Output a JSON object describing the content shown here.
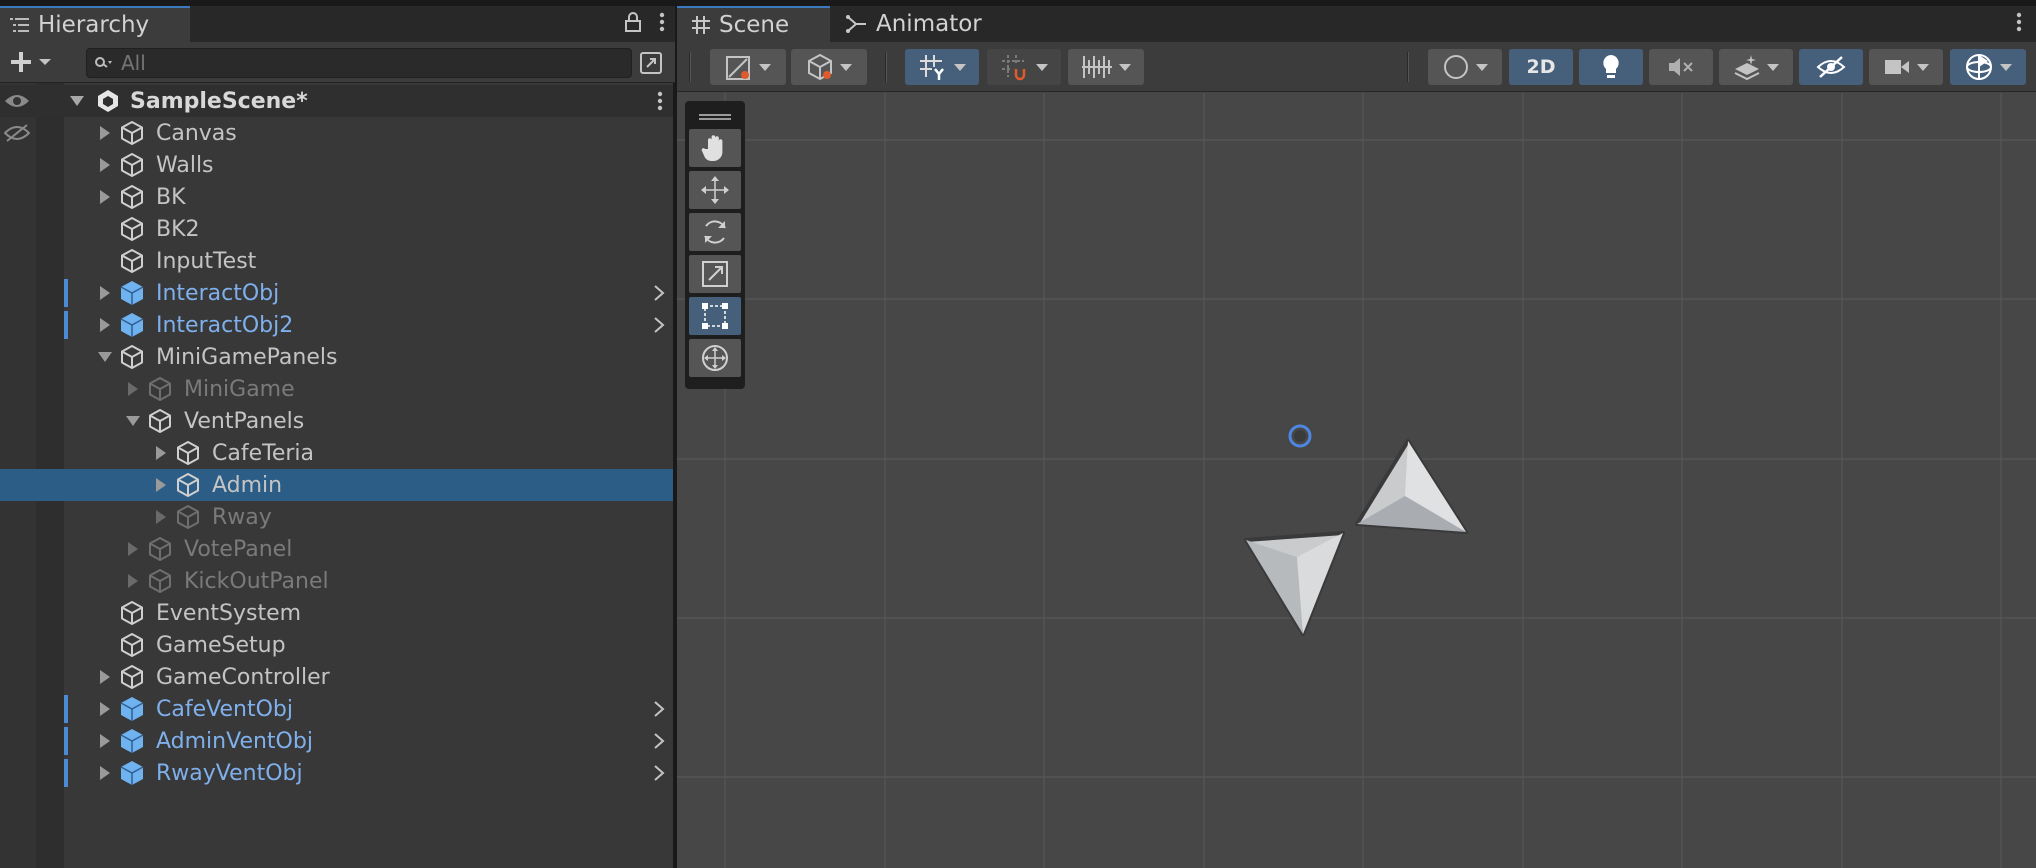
{
  "hierarchy": {
    "tab_title": "Hierarchy",
    "search_placeholder": "All",
    "scene_name": "SampleScene*",
    "items": [
      {
        "label": "Canvas",
        "type": "normal",
        "indent": 0,
        "fold": "collapsed",
        "mark": false
      },
      {
        "label": "Walls",
        "type": "normal",
        "indent": 0,
        "fold": "collapsed",
        "mark": false
      },
      {
        "label": "BK",
        "type": "normal",
        "indent": 0,
        "fold": "collapsed",
        "mark": false
      },
      {
        "label": "BK2",
        "type": "normal",
        "indent": 0,
        "fold": "none",
        "mark": false
      },
      {
        "label": "InputTest",
        "type": "normal",
        "indent": 0,
        "fold": "none",
        "mark": false
      },
      {
        "label": "InteractObj",
        "type": "prefab",
        "indent": 0,
        "fold": "collapsed",
        "mark": true
      },
      {
        "label": "InteractObj2",
        "type": "prefab",
        "indent": 0,
        "fold": "collapsed",
        "mark": true
      },
      {
        "label": "MiniGamePanels",
        "type": "normal",
        "indent": 0,
        "fold": "expanded",
        "mark": false
      },
      {
        "label": "MiniGame",
        "type": "disabled",
        "indent": 1,
        "fold": "collapsed",
        "mark": false
      },
      {
        "label": "VentPanels",
        "type": "normal",
        "indent": 1,
        "fold": "expanded",
        "mark": false
      },
      {
        "label": "CafeTeria",
        "type": "normal",
        "indent": 2,
        "fold": "collapsed",
        "mark": false
      },
      {
        "label": "Admin",
        "type": "selected",
        "indent": 2,
        "fold": "collapsed",
        "mark": false
      },
      {
        "label": "Rway",
        "type": "disabled",
        "indent": 2,
        "fold": "collapsed",
        "mark": false
      },
      {
        "label": "VotePanel",
        "type": "disabled",
        "indent": 1,
        "fold": "collapsed",
        "mark": false
      },
      {
        "label": "KickOutPanel",
        "type": "disabled",
        "indent": 1,
        "fold": "collapsed",
        "mark": false
      },
      {
        "label": "EventSystem",
        "type": "normal",
        "indent": 0,
        "fold": "none",
        "mark": false
      },
      {
        "label": "GameSetup",
        "type": "normal",
        "indent": 0,
        "fold": "none",
        "mark": false
      },
      {
        "label": "GameController",
        "type": "normal",
        "indent": 0,
        "fold": "collapsed",
        "mark": false
      },
      {
        "label": "CafeVentObj",
        "type": "prefab",
        "indent": 0,
        "fold": "collapsed",
        "mark": true
      },
      {
        "label": "AdminVentObj",
        "type": "prefab",
        "indent": 0,
        "fold": "collapsed",
        "mark": true
      },
      {
        "label": "RwayVentObj",
        "type": "prefab",
        "indent": 0,
        "fold": "collapsed",
        "mark": true
      }
    ]
  },
  "scene_panel": {
    "tabs": [
      {
        "label": "Scene",
        "icon": "hash-icon"
      },
      {
        "label": "Animator",
        "icon": "animator-icon"
      }
    ],
    "toolbar": {
      "mode_2d_label": "2D"
    },
    "tools": [
      "hand-tool",
      "move-tool",
      "rotate-tool",
      "scale-tool",
      "rect-tool",
      "transform-tool"
    ],
    "active_tool": "rect-tool"
  },
  "colors": {
    "accent": "#3a79bb",
    "prefab_text": "#7fb0ec",
    "selection": "#2c5d87",
    "active_button": "#46607c"
  }
}
